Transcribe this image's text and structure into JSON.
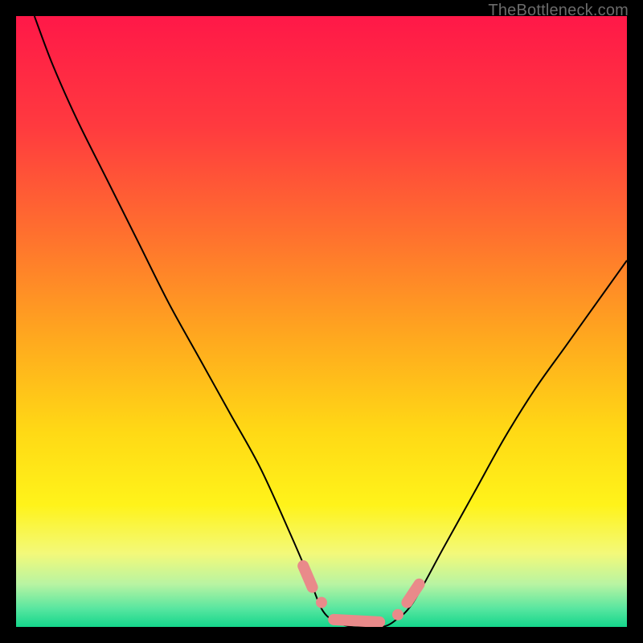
{
  "watermark": "TheBottleneck.com",
  "chart_data": {
    "type": "line",
    "title": "",
    "xlabel": "",
    "ylabel": "",
    "xlim": [
      0,
      100
    ],
    "ylim": [
      0,
      100
    ],
    "series": [
      {
        "name": "bottleneck-curve",
        "x": [
          3,
          6,
          10,
          15,
          20,
          25,
          30,
          35,
          40,
          45,
          48,
          50,
          52,
          55,
          58,
          60,
          62,
          65,
          70,
          75,
          80,
          85,
          90,
          95,
          100
        ],
        "y": [
          100,
          92,
          83,
          73,
          63,
          53,
          44,
          35,
          26,
          15,
          8,
          3,
          1,
          0,
          0,
          0,
          1,
          4,
          13,
          22,
          31,
          39,
          46,
          53,
          60
        ]
      }
    ],
    "markers": [
      {
        "name": "pink-segment-left-1",
        "type": "segment",
        "x1": 47.0,
        "y1": 10.0,
        "x2": 48.5,
        "y2": 6.5
      },
      {
        "name": "pink-dot-left-2",
        "type": "dot",
        "x": 50.0,
        "y": 4.0
      },
      {
        "name": "pink-segment-flat",
        "type": "segment",
        "x1": 52.0,
        "y1": 1.2,
        "x2": 59.5,
        "y2": 0.8
      },
      {
        "name": "pink-dot-right-1",
        "type": "dot",
        "x": 62.5,
        "y": 2.0
      },
      {
        "name": "pink-segment-right-2",
        "type": "segment",
        "x1": 64.0,
        "y1": 4.0,
        "x2": 66.0,
        "y2": 7.0
      }
    ],
    "background": {
      "type": "vertical-gradient",
      "stops": [
        {
          "pos": 0.0,
          "color": "#ff1848"
        },
        {
          "pos": 0.18,
          "color": "#ff3a3f"
        },
        {
          "pos": 0.35,
          "color": "#ff6e2f"
        },
        {
          "pos": 0.52,
          "color": "#ffa61f"
        },
        {
          "pos": 0.68,
          "color": "#ffd915"
        },
        {
          "pos": 0.8,
          "color": "#fff31a"
        },
        {
          "pos": 0.88,
          "color": "#f3f97a"
        },
        {
          "pos": 0.93,
          "color": "#b8f4a2"
        },
        {
          "pos": 0.97,
          "color": "#58e6a0"
        },
        {
          "pos": 1.0,
          "color": "#14d68b"
        }
      ]
    }
  }
}
